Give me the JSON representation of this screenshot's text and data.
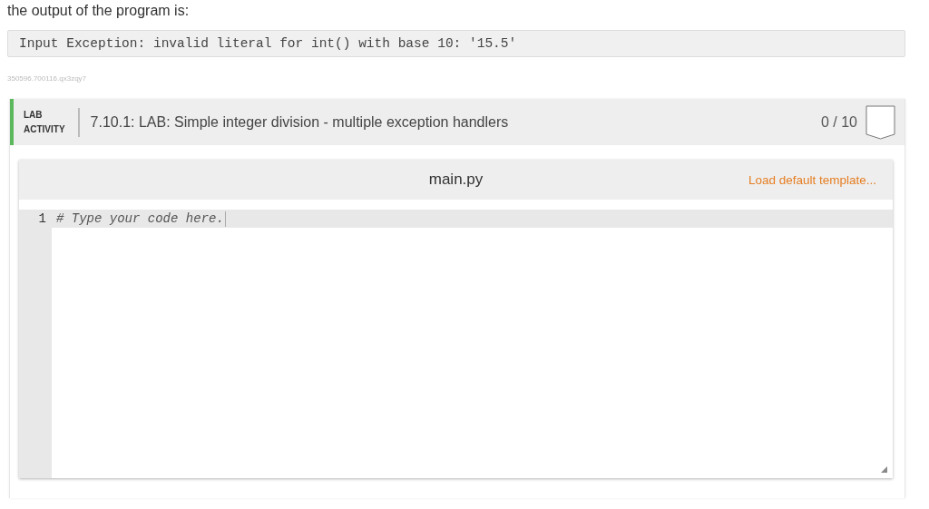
{
  "intro": "the output of the program is:",
  "output": "Input Exception: invalid literal for int() with base 10: '15.5'",
  "content_id": "350596.700116.qx3zqy7",
  "lab": {
    "label_lines": [
      "LAB",
      "ACTIVITY"
    ],
    "title": "7.10.1: LAB: Simple integer division - multiple exception handlers",
    "score": "0 / 10"
  },
  "editor": {
    "filename": "main.py",
    "template_link": "Load default template...",
    "lines": [
      {
        "number": "1",
        "code": "# Type your code here."
      }
    ]
  }
}
